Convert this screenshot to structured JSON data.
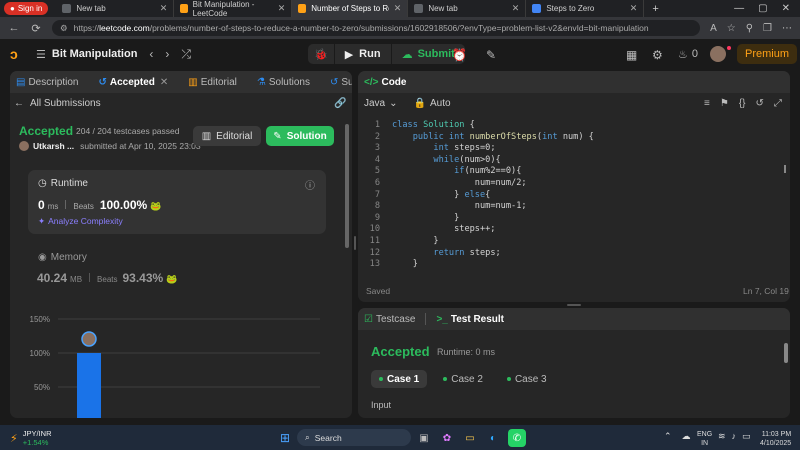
{
  "browser": {
    "signin_label": "Sign in",
    "tabs": [
      {
        "title": "New tab",
        "color": "#5f6368"
      },
      {
        "title": "Bit Manipulation - LeetCode",
        "color": "#ffa116"
      },
      {
        "title": "Number of Steps to Reduce a",
        "color": "#ffa116"
      },
      {
        "title": "New tab",
        "color": "#5f6368"
      },
      {
        "title": "Steps to Zero",
        "color": "#4285f4"
      }
    ],
    "new_tab": "+",
    "url_host": "leetcode.com",
    "url_prefix": "https://",
    "url_path": "/problems/number-of-steps-to-reduce-a-number-to-zero/submissions/1602918506/?envType=problem-list-v2&envId=bit-manipulation"
  },
  "header": {
    "list_title": "Bit Manipulation",
    "run_label": "Run",
    "submit_label": "Submit",
    "streak_count": "0",
    "premium_label": "Premium"
  },
  "left": {
    "tabs": [
      {
        "label": "Description"
      },
      {
        "label": "Accepted"
      },
      {
        "label": "Editorial"
      },
      {
        "label": "Solutions"
      },
      {
        "label": "Submissions"
      }
    ],
    "back_label": "All Submissions",
    "status": "Accepted",
    "testcases": "204 / 204 testcases passed",
    "user": "Utkarsh ...",
    "submitted": "submitted at Apr 10, 2025 23:03",
    "editorial_btn": "Editorial",
    "solution_btn": "Solution",
    "runtime": {
      "title": "Runtime",
      "value": "0",
      "unit": "ms",
      "beats_label": "Beats",
      "beats_value": "100.00%",
      "analyze": "Analyze Complexity"
    },
    "memory": {
      "title": "Memory",
      "value": "40.24",
      "unit": "MB",
      "beats_label": "Beats",
      "beats_value": "93.43%"
    },
    "chart_data": {
      "type": "bar",
      "y_ticks": [
        "150%",
        "100%",
        "50%"
      ],
      "ylim": [
        0,
        150
      ],
      "values": [
        100
      ],
      "bar_color": "#1a73e8"
    }
  },
  "editor": {
    "title": "Code",
    "language": "Java",
    "mode": "Auto",
    "lines": [
      {
        "n": "1",
        "html": "<span class='kw'>class</span> <span class='ty'>Solution</span> <span class='tx'>{</span>"
      },
      {
        "n": "2",
        "html": "    <span class='kw'>public int</span> <span class='fn'>numberOfSteps</span><span class='tx'>(</span><span class='kw'>int</span> <span class='tx'>num) {</span>"
      },
      {
        "n": "3",
        "html": "        <span class='kw'>int</span> <span class='tx'>steps=0;</span>"
      },
      {
        "n": "4",
        "html": "        <span class='kw'>while</span><span class='tx'>(num&gt;0){</span>"
      },
      {
        "n": "5",
        "html": "            <span class='kw'>if</span><span class='tx'>(num%2==0){</span>"
      },
      {
        "n": "6",
        "html": "                <span class='tx'>num=num/2;</span>"
      },
      {
        "n": "7",
        "html": "            <span class='tx'>} </span><span class='kw'>else</span><span class='tx'>{</span>"
      },
      {
        "n": "8",
        "html": "                <span class='tx'>num=num-1;</span>"
      },
      {
        "n": "9",
        "html": "            <span class='tx'>}</span>"
      },
      {
        "n": "10",
        "html": "            <span class='tx'>steps++;</span>"
      },
      {
        "n": "11",
        "html": "        <span class='tx'>}</span>"
      },
      {
        "n": "12",
        "html": "        <span class='kw'>return</span> <span class='tx'>steps;</span>"
      },
      {
        "n": "13",
        "html": "    <span class='tx'>}</span>"
      }
    ],
    "saved": "Saved",
    "cursor": "Ln 7, Col 19"
  },
  "result": {
    "tabs": [
      {
        "label": "Testcase"
      },
      {
        "label": "Test Result"
      }
    ],
    "status": "Accepted",
    "runtime": "Runtime: 0 ms",
    "cases": [
      {
        "label": "Case 1"
      },
      {
        "label": "Case 2"
      },
      {
        "label": "Case 3"
      }
    ],
    "input_label": "Input"
  },
  "taskbar": {
    "ticker": "JPY/INR",
    "ticker_change": "+1.54%",
    "search_label": "Search",
    "lang": "ENG",
    "region": "IN",
    "time": "11:03 PM",
    "date": "4/10/2025"
  }
}
